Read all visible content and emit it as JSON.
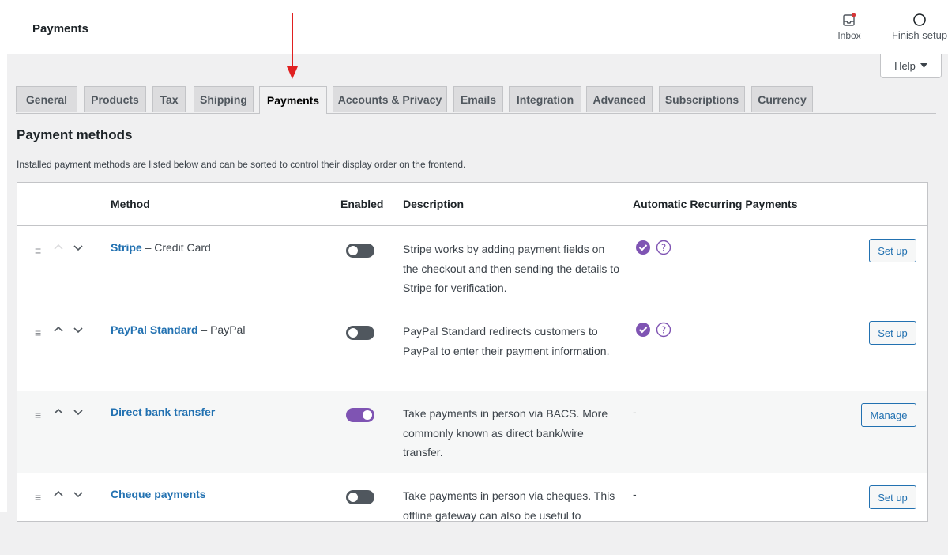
{
  "header": {
    "title": "Payments",
    "inbox_label": "Inbox",
    "finish_label": "Finish setup",
    "help_label": "Help",
    "accent_color": "#7f54b3",
    "annotation_arrow_color": "#e02020"
  },
  "tabs": [
    {
      "label": "General"
    },
    {
      "label": "Products"
    },
    {
      "label": "Tax"
    },
    {
      "label": "Shipping"
    },
    {
      "label": "Payments",
      "active": true
    },
    {
      "label": "Accounts & Privacy"
    },
    {
      "label": "Emails"
    },
    {
      "label": "Integration"
    },
    {
      "label": "Advanced"
    },
    {
      "label": "Subscriptions"
    },
    {
      "label": "Currency"
    }
  ],
  "section": {
    "title": "Payment methods",
    "description": "Installed payment methods are listed below and can be sorted to control their display order on the frontend."
  },
  "table": {
    "headers": {
      "method": "Method",
      "enabled": "Enabled",
      "description": "Description",
      "recurring": "Automatic Recurring Payments"
    },
    "rows": [
      {
        "name": "Stripe",
        "suffix": " – Credit Card",
        "enabled": false,
        "description": "Stripe works by adding payment fields on the checkout and then sending the details to Stripe for verification.",
        "recurring": "supported",
        "recurring_text": "",
        "action": "Set up"
      },
      {
        "name": "PayPal Standard",
        "suffix": " – PayPal",
        "enabled": false,
        "description": "PayPal Standard redirects customers to PayPal to enter their payment information.",
        "recurring": "supported",
        "recurring_text": "",
        "action": "Set up"
      },
      {
        "name": "Direct bank transfer",
        "suffix": "",
        "enabled": true,
        "description": "Take payments in person via BACS. More commonly known as direct bank/wire transfer.",
        "recurring": "none",
        "recurring_text": "-",
        "action": "Manage"
      },
      {
        "name": "Cheque payments",
        "suffix": "",
        "enabled": false,
        "description": "Take payments in person via cheques. This offline gateway can also be useful to",
        "recurring": "none",
        "recurring_text": "-",
        "action": "Set up"
      }
    ]
  }
}
